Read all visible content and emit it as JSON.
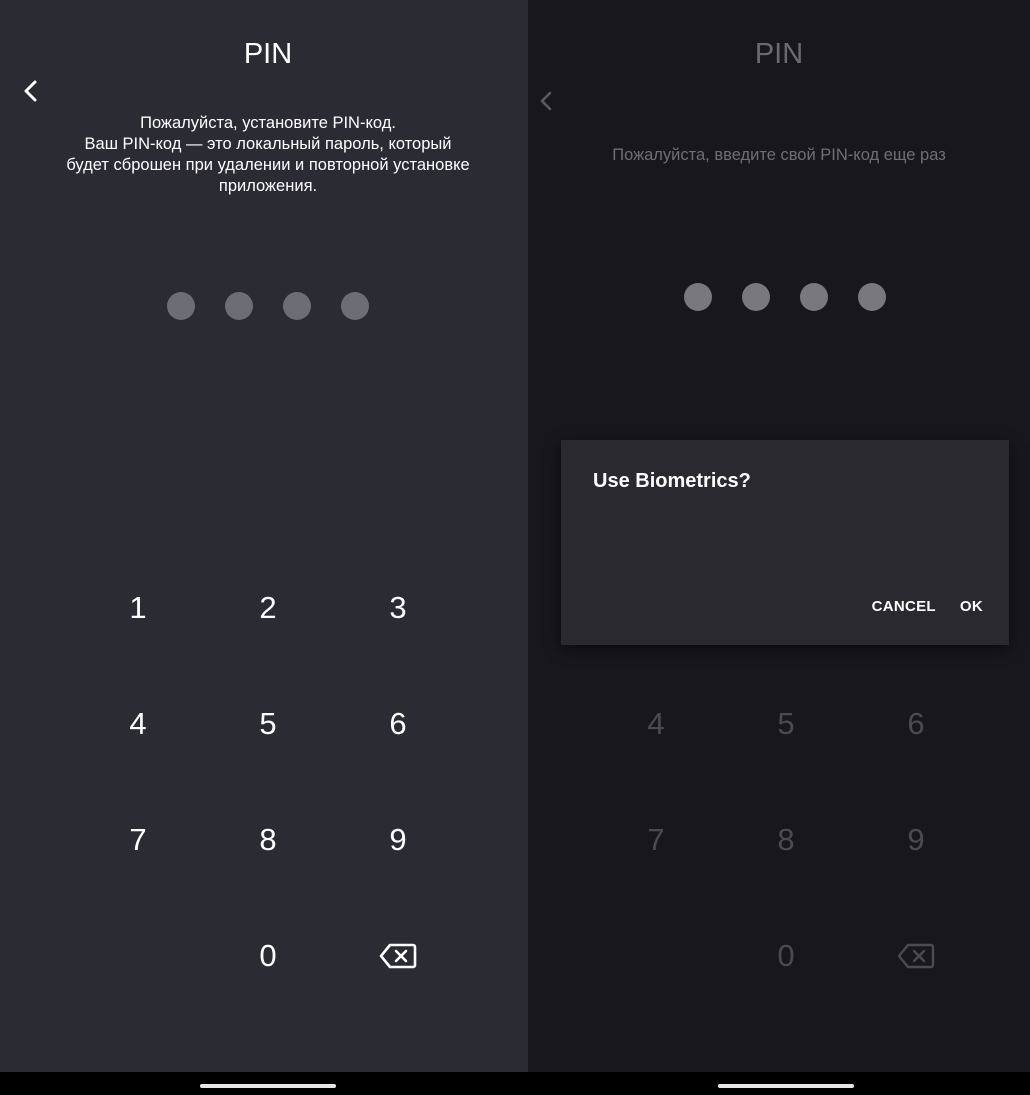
{
  "left_screen": {
    "title": "PIN",
    "description_lines": [
      "Пожалуйста, установите PIN-код.",
      "Ваш PIN-код — это локальный пароль, который",
      "будет сброшен при удалении и повторной установке",
      "приложения."
    ],
    "pin_dots_count": 4,
    "keypad": {
      "k1": "1",
      "k2": "2",
      "k3": "3",
      "k4": "4",
      "k5": "5",
      "k6": "6",
      "k7": "7",
      "k8": "8",
      "k9": "9",
      "k0": "0"
    }
  },
  "right_screen": {
    "title": "PIN",
    "description": "Пожалуйста, введите свой PIN-код еще раз",
    "pin_dots_count": 4,
    "keypad": {
      "k4": "4",
      "k5": "5",
      "k6": "6",
      "k7": "7",
      "k8": "8",
      "k9": "9",
      "k0": "0"
    },
    "dialog": {
      "title": "Use Biometrics?",
      "cancel_label": "CANCEL",
      "ok_label": "OK"
    }
  },
  "icons": {
    "back": "chevron-left-icon",
    "delete": "backspace-icon"
  },
  "colors": {
    "left_background": "#2b2b33",
    "right_background": "#18181c",
    "dialog_background": "#29292f",
    "dot_color": "#6d6d74"
  }
}
